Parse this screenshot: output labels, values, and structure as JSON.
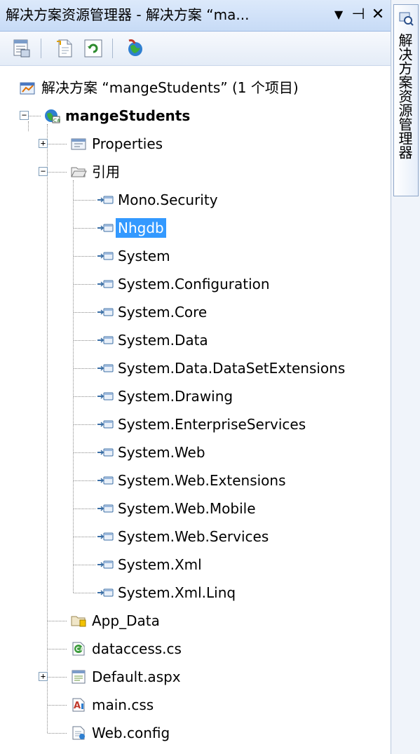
{
  "window": {
    "title": "解决方案资源管理器 - 解决方案 “ma...",
    "dropdown_glyph": "▼",
    "pin_glyph": "⊣",
    "close_glyph": "✕"
  },
  "side_tab": {
    "label": "解决方案资源管理器"
  },
  "tree": {
    "solution": "解决方案 “mangeStudents” (1 个项目)",
    "project": "mangeStudents",
    "properties": "Properties",
    "references_folder": "引用",
    "references": [
      "Mono.Security",
      "Nhgdb",
      "System",
      "System.Configuration",
      "System.Core",
      "System.Data",
      "System.Data.DataSetExtensions",
      "System.Drawing",
      "System.EnterpriseServices",
      "System.Web",
      "System.Web.Extensions",
      "System.Web.Mobile",
      "System.Web.Services",
      "System.Xml",
      "System.Xml.Linq"
    ],
    "selected_reference": "Nhgdb",
    "files": [
      "App_Data",
      "dataccess.cs",
      "Default.aspx",
      "main.css",
      "Web.config"
    ],
    "expand_collapsed": "+",
    "expand_expanded": "−"
  },
  "colors": {
    "selection": "#3399ff",
    "titlebar": "#c7dbf6",
    "tree_line": "#8a8a8a"
  }
}
